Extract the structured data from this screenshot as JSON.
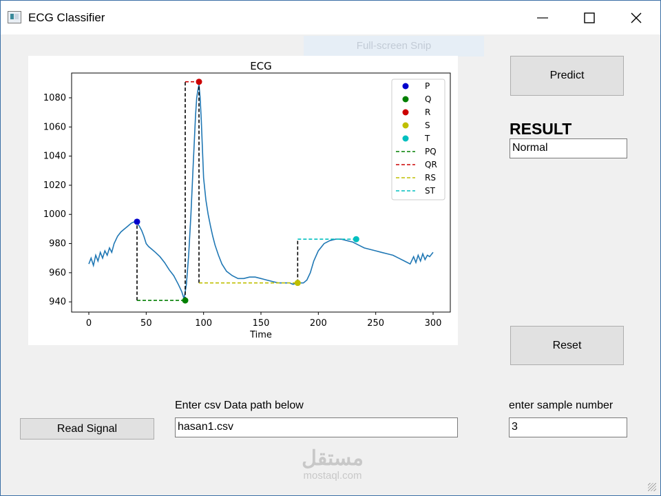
{
  "window": {
    "title": "ECG Classifier",
    "app_icon": "app-window-icon",
    "controls": [
      "minimize-icon",
      "maximize-icon",
      "close-icon"
    ]
  },
  "overlay": {
    "snip_banner": "Full-screen Snip"
  },
  "buttons": {
    "predict": "Predict",
    "reset": "Reset",
    "read_signal": "Read Signal"
  },
  "result": {
    "heading": "RESULT",
    "value": "Normal"
  },
  "inputs": {
    "path_label": "Enter csv Data path below",
    "path_value": "hasan1.csv",
    "sample_label": "enter sample number",
    "sample_value": "3"
  },
  "watermark": {
    "logo": "مستقل",
    "text": "mostaql.com"
  },
  "chart_data": {
    "type": "line",
    "title": "ECG",
    "xlabel": "Time",
    "ylabel": "",
    "xlim": [
      -15,
      315
    ],
    "ylim": [
      933,
      1097
    ],
    "xticks": [
      0,
      50,
      100,
      150,
      200,
      250,
      300
    ],
    "yticks": [
      940,
      960,
      980,
      1000,
      1020,
      1040,
      1060,
      1080
    ],
    "grid": false,
    "legend_position": "top-right",
    "signal": {
      "color": "#1f77b4",
      "x": [
        0,
        2,
        4,
        6,
        8,
        10,
        12,
        14,
        16,
        18,
        20,
        22,
        25,
        28,
        31,
        34,
        37,
        40,
        42,
        44,
        46,
        48,
        50,
        52,
        55,
        58,
        62,
        66,
        70,
        74,
        78,
        81,
        83,
        85,
        87,
        89,
        91,
        93,
        94,
        95,
        96,
        97,
        98,
        99,
        100,
        102,
        104,
        106,
        108,
        110,
        113,
        116,
        120,
        125,
        130,
        135,
        140,
        145,
        150,
        155,
        160,
        165,
        170,
        175,
        178,
        181,
        184,
        187,
        190,
        193,
        196,
        200,
        205,
        210,
        215,
        220,
        225,
        230,
        235,
        240,
        245,
        250,
        255,
        260,
        265,
        270,
        275,
        280,
        283,
        285,
        287,
        289,
        291,
        293,
        295,
        297,
        300
      ],
      "y": [
        966,
        970,
        965,
        972,
        968,
        974,
        970,
        975,
        972,
        977,
        974,
        980,
        985,
        988,
        990,
        992,
        994,
        995,
        994,
        992,
        989,
        985,
        980,
        978,
        976,
        974,
        971,
        967,
        962,
        958,
        952,
        947,
        942,
        952,
        972,
        1000,
        1035,
        1068,
        1080,
        1085,
        1089,
        1080,
        1065,
        1045,
        1025,
        1010,
        1000,
        992,
        985,
        979,
        972,
        966,
        961,
        958,
        956,
        956,
        957,
        957,
        956,
        955,
        954,
        953,
        953,
        953,
        952,
        953,
        953,
        953,
        955,
        960,
        968,
        975,
        980,
        982,
        983,
        983,
        982,
        981,
        979,
        977,
        976,
        975,
        974,
        973,
        972,
        970,
        968,
        966,
        971,
        967,
        972,
        968,
        973,
        969,
        972,
        971,
        974
      ]
    },
    "points": [
      {
        "name": "P",
        "x": 42,
        "y": 995,
        "color": "#0000cc"
      },
      {
        "name": "Q",
        "x": 84,
        "y": 941,
        "color": "#007f00"
      },
      {
        "name": "R",
        "x": 96,
        "y": 1091,
        "color": "#cc0000"
      },
      {
        "name": "S",
        "x": 182,
        "y": 953,
        "color": "#bfbf00"
      },
      {
        "name": "T",
        "x": 233,
        "y": 983,
        "color": "#00bfbf"
      }
    ],
    "intervals": [
      {
        "name": "PQ",
        "x": [
          42,
          84
        ],
        "y": 941,
        "color": "#007f00"
      },
      {
        "name": "QR",
        "x": [
          84,
          96
        ],
        "y": 1091,
        "color": "#cc0000"
      },
      {
        "name": "RS",
        "x": [
          96,
          182
        ],
        "y": 953,
        "color": "#bfbf00"
      },
      {
        "name": "ST",
        "x": [
          182,
          233
        ],
        "y": 983,
        "color": "#00bfbf"
      }
    ],
    "drops": [
      {
        "x": 42,
        "y": [
          941,
          995
        ]
      },
      {
        "x": 84,
        "y": [
          941,
          1091
        ]
      },
      {
        "x": 96,
        "y": [
          953,
          1091
        ]
      },
      {
        "x": 182,
        "y": [
          953,
          983
        ]
      }
    ],
    "legend": [
      {
        "label": "P",
        "kind": "marker",
        "color": "#0000cc"
      },
      {
        "label": "Q",
        "kind": "marker",
        "color": "#007f00"
      },
      {
        "label": "R",
        "kind": "marker",
        "color": "#cc0000"
      },
      {
        "label": "S",
        "kind": "marker",
        "color": "#bfbf00"
      },
      {
        "label": "T",
        "kind": "marker",
        "color": "#00bfbf"
      },
      {
        "label": "PQ",
        "kind": "dashed",
        "color": "#007f00"
      },
      {
        "label": "QR",
        "kind": "dashed",
        "color": "#cc0000"
      },
      {
        "label": "RS",
        "kind": "dashed",
        "color": "#bfbf00"
      },
      {
        "label": "ST",
        "kind": "dashed",
        "color": "#00bfbf"
      }
    ]
  }
}
